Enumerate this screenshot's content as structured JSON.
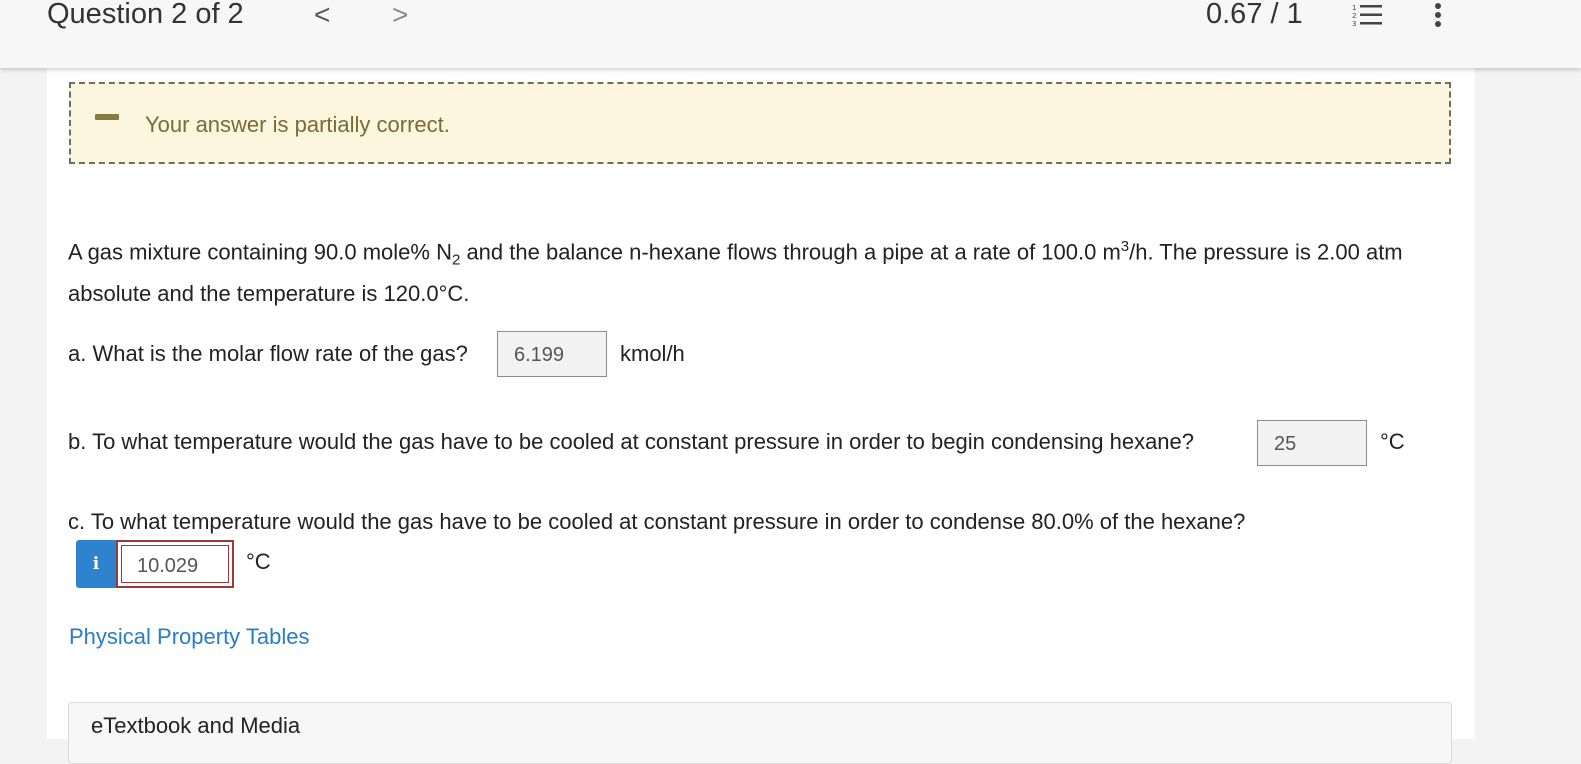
{
  "header": {
    "question_title": "Question 2 of 2",
    "prev_glyph": "<",
    "next_glyph": ">",
    "score": "0.67 / 1",
    "list_icon": "numbered-list-icon",
    "more_icon": "vertical-ellipsis-icon"
  },
  "feedback": {
    "message": "Your answer is partially correct.",
    "icon": "partial-dash-icon",
    "color": "#fdf6de"
  },
  "problem": {
    "text_1": "A gas mixture containing 90.0 mole% N",
    "sub_1": "2",
    "text_2": " and the balance n-hexane flows through a pipe at a rate of 100.0 m",
    "sup_1": "3",
    "text_3": "/h. The pressure is 2.00 atm absolute and the temperature is 120.0°C."
  },
  "parts": {
    "a": {
      "question": "a. What is the molar flow rate of the gas?",
      "value": "6.199",
      "unit": "kmol/h"
    },
    "b": {
      "question": "b. To what temperature would the gas have to be cooled at constant pressure in order to begin condensing hexane?",
      "value": "25",
      "unit": "°C"
    },
    "c": {
      "question": "c. To what temperature would the gas have to be cooled at constant pressure in order to condense 80.0% of the hexane?",
      "info_glyph": "i",
      "value": "10.029",
      "unit": "°C"
    }
  },
  "links": {
    "property_tables": "Physical Property Tables"
  },
  "resources": {
    "title": "eTextbook and Media"
  },
  "colors": {
    "link": "#2a7bc8",
    "info_button": "#2e83cf",
    "incorrect_border": "#9b3a3a"
  }
}
